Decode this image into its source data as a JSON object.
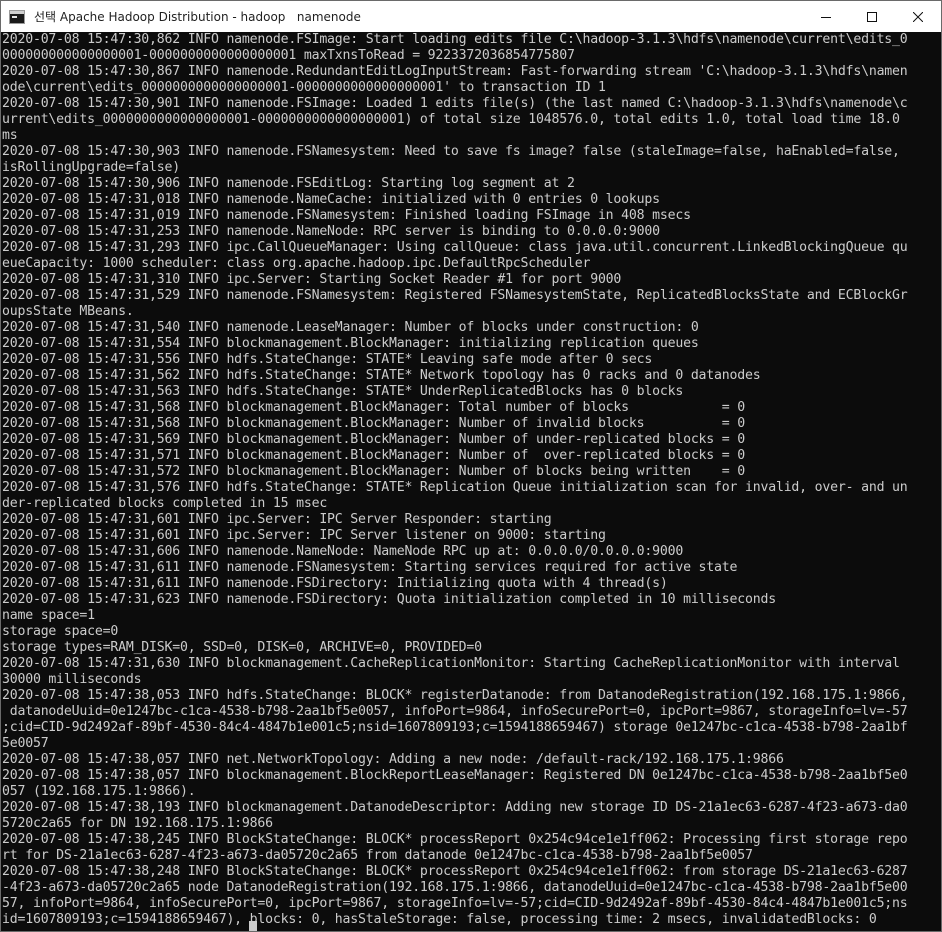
{
  "window": {
    "title": "선택 Apache Hadoop Distribution - hadoop   namenode",
    "controls": {
      "minimize": "minimize",
      "maximize": "maximize",
      "close": "close"
    }
  },
  "console": {
    "lines": [
      "2020-07-08 15:47:30,862 INFO namenode.FSImage: Start loading edits file C:\\hadoop-3.1.3\\hdfs\\namenode\\current\\edits_0",
      "000000000000000001-0000000000000000001 maxTxnsToRead = 9223372036854775807",
      "2020-07-08 15:47:30,867 INFO namenode.RedundantEditLogInputStream: Fast-forwarding stream 'C:\\hadoop-3.1.3\\hdfs\\namen",
      "ode\\current\\edits_0000000000000000001-0000000000000000001' to transaction ID 1",
      "2020-07-08 15:47:30,901 INFO namenode.FSImage: Loaded 1 edits file(s) (the last named C:\\hadoop-3.1.3\\hdfs\\namenode\\c",
      "urrent\\edits_0000000000000000001-0000000000000000001) of total size 1048576.0, total edits 1.0, total load time 18.0",
      "ms",
      "2020-07-08 15:47:30,903 INFO namenode.FSNamesystem: Need to save fs image? false (staleImage=false, haEnabled=false,",
      "isRollingUpgrade=false)",
      "2020-07-08 15:47:30,906 INFO namenode.FSEditLog: Starting log segment at 2",
      "2020-07-08 15:47:31,018 INFO namenode.NameCache: initialized with 0 entries 0 lookups",
      "2020-07-08 15:47:31,019 INFO namenode.FSNamesystem: Finished loading FSImage in 408 msecs",
      "2020-07-08 15:47:31,253 INFO namenode.NameNode: RPC server is binding to 0.0.0.0:9000",
      "2020-07-08 15:47:31,293 INFO ipc.CallQueueManager: Using callQueue: class java.util.concurrent.LinkedBlockingQueue qu",
      "eueCapacity: 1000 scheduler: class org.apache.hadoop.ipc.DefaultRpcScheduler",
      "2020-07-08 15:47:31,310 INFO ipc.Server: Starting Socket Reader #1 for port 9000",
      "2020-07-08 15:47:31,529 INFO namenode.FSNamesystem: Registered FSNamesystemState, ReplicatedBlocksState and ECBlockGr",
      "oupsState MBeans.",
      "2020-07-08 15:47:31,540 INFO namenode.LeaseManager: Number of blocks under construction: 0",
      "2020-07-08 15:47:31,554 INFO blockmanagement.BlockManager: initializing replication queues",
      "2020-07-08 15:47:31,556 INFO hdfs.StateChange: STATE* Leaving safe mode after 0 secs",
      "2020-07-08 15:47:31,562 INFO hdfs.StateChange: STATE* Network topology has 0 racks and 0 datanodes",
      "2020-07-08 15:47:31,563 INFO hdfs.StateChange: STATE* UnderReplicatedBlocks has 0 blocks",
      "2020-07-08 15:47:31,568 INFO blockmanagement.BlockManager: Total number of blocks            = 0",
      "2020-07-08 15:47:31,568 INFO blockmanagement.BlockManager: Number of invalid blocks          = 0",
      "2020-07-08 15:47:31,569 INFO blockmanagement.BlockManager: Number of under-replicated blocks = 0",
      "2020-07-08 15:47:31,571 INFO blockmanagement.BlockManager: Number of  over-replicated blocks = 0",
      "2020-07-08 15:47:31,572 INFO blockmanagement.BlockManager: Number of blocks being written    = 0",
      "2020-07-08 15:47:31,576 INFO hdfs.StateChange: STATE* Replication Queue initialization scan for invalid, over- and un",
      "der-replicated blocks completed in 15 msec",
      "2020-07-08 15:47:31,601 INFO ipc.Server: IPC Server Responder: starting",
      "2020-07-08 15:47:31,601 INFO ipc.Server: IPC Server listener on 9000: starting",
      "2020-07-08 15:47:31,606 INFO namenode.NameNode: NameNode RPC up at: 0.0.0.0/0.0.0.0:9000",
      "2020-07-08 15:47:31,611 INFO namenode.FSNamesystem: Starting services required for active state",
      "2020-07-08 15:47:31,611 INFO namenode.FSDirectory: Initializing quota with 4 thread(s)",
      "2020-07-08 15:47:31,623 INFO namenode.FSDirectory: Quota initialization completed in 10 milliseconds",
      "name space=1",
      "storage space=0",
      "storage types=RAM_DISK=0, SSD=0, DISK=0, ARCHIVE=0, PROVIDED=0",
      "2020-07-08 15:47:31,630 INFO blockmanagement.CacheReplicationMonitor: Starting CacheReplicationMonitor with interval",
      "30000 milliseconds",
      "2020-07-08 15:47:38,053 INFO hdfs.StateChange: BLOCK* registerDatanode: from DatanodeRegistration(192.168.175.1:9866,",
      " datanodeUuid=0e1247bc-c1ca-4538-b798-2aa1bf5e0057, infoPort=9864, infoSecurePort=0, ipcPort=9867, storageInfo=lv=-57",
      ";cid=CID-9d2492af-89bf-4530-84c4-4847b1e001c5;nsid=1607809193;c=1594188659467) storage 0e1247bc-c1ca-4538-b798-2aa1bf",
      "5e0057",
      "2020-07-08 15:47:38,057 INFO net.NetworkTopology: Adding a new node: /default-rack/192.168.175.1:9866",
      "2020-07-08 15:47:38,057 INFO blockmanagement.BlockReportLeaseManager: Registered DN 0e1247bc-c1ca-4538-b798-2aa1bf5e0",
      "057 (192.168.175.1:9866).",
      "2020-07-08 15:47:38,193 INFO blockmanagement.DatanodeDescriptor: Adding new storage ID DS-21a1ec63-6287-4f23-a673-da0",
      "5720c2a65 for DN 192.168.175.1:9866",
      "2020-07-08 15:47:38,245 INFO BlockStateChange: BLOCK* processReport 0x254c94ce1e1ff062: Processing first storage repo",
      "rt for DS-21a1ec63-6287-4f23-a673-da05720c2a65 from datanode 0e1247bc-c1ca-4538-b798-2aa1bf5e0057",
      "2020-07-08 15:47:38,248 INFO BlockStateChange: BLOCK* processReport 0x254c94ce1e1ff062: from storage DS-21a1ec63-6287",
      "-4f23-a673-da05720c2a65 node DatanodeRegistration(192.168.175.1:9866, datanodeUuid=0e1247bc-c1ca-4538-b798-2aa1bf5e00",
      "57, infoPort=9864, infoSecurePort=0, ipcPort=9867, storageInfo=lv=-57;cid=CID-9d2492af-89bf-4530-84c4-4847b1e001c5;ns",
      "id=1607809193;c=1594188659467), blocks: 0, hasStaleStorage: false, processing time: 2 msecs, invalidatedBlocks: 0"
    ]
  }
}
